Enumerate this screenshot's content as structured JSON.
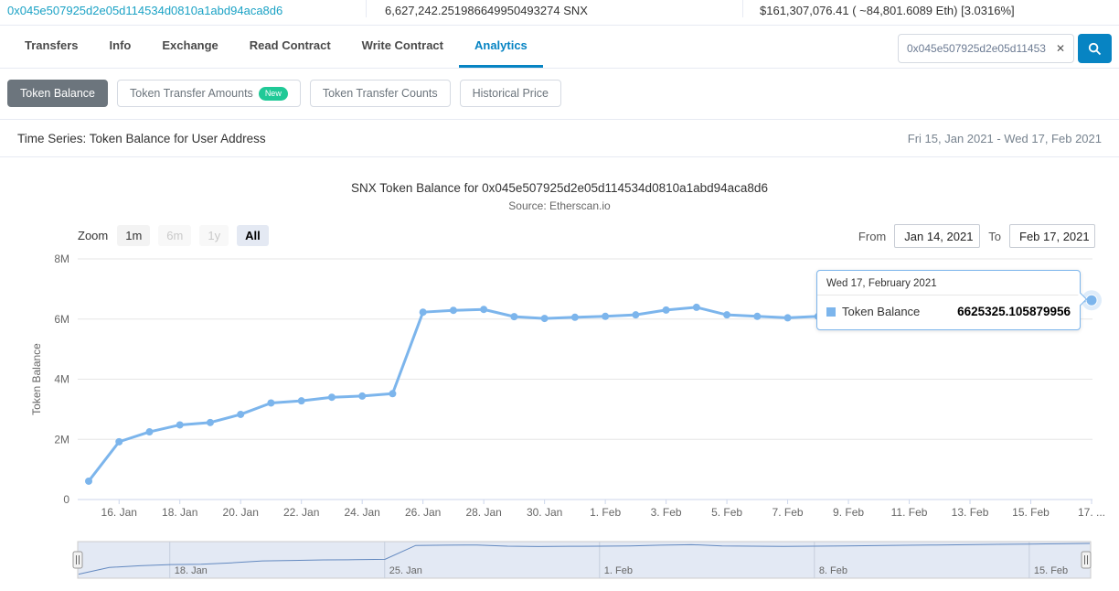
{
  "colors": {
    "accent": "#0784c3",
    "address_link": "#1ba2c5",
    "series": "#7cb5ec",
    "active_subtab_bg": "#6c757d",
    "new_badge_bg": "#20c997"
  },
  "topbar": {
    "address": "0x045e507925d2e05d114534d0810a1abd94aca8d6",
    "token_amount": "6,627,242.251986649950493274 SNX",
    "usd_value": "$161,307,076.41 ( ~84,801.6089 Eth) [3.0316%]"
  },
  "nav": {
    "tabs": [
      {
        "label": "Transfers"
      },
      {
        "label": "Info"
      },
      {
        "label": "Exchange"
      },
      {
        "label": "Read Contract"
      },
      {
        "label": "Write Contract"
      },
      {
        "label": "Analytics"
      }
    ],
    "search": {
      "value": "0x045e507925d2e05d11453...",
      "clear_glyph": "✕"
    }
  },
  "subtabs": {
    "token_balance": "Token Balance",
    "token_transfer_amounts": "Token Transfer Amounts",
    "new_badge": "New",
    "token_transfer_counts": "Token Transfer Counts",
    "historical_price": "Historical Price"
  },
  "panel": {
    "title": "Time Series: Token Balance for User Address",
    "date_range": "Fri 15, Jan 2021 - Wed 17, Feb 2021"
  },
  "toolbar": {
    "zoom_label": "Zoom",
    "zoom_buttons": [
      {
        "label": "1m",
        "state": "normal"
      },
      {
        "label": "6m",
        "state": "disabled"
      },
      {
        "label": "1y",
        "state": "disabled"
      },
      {
        "label": "All",
        "state": "active"
      }
    ],
    "from_label": "From",
    "from_value": "Jan 14, 2021",
    "to_label": "To",
    "to_value": "Feb 17, 2021"
  },
  "tooltip": {
    "header": "Wed 17, February 2021",
    "series_name": "Token Balance",
    "value": "6625325.105879956"
  },
  "chart_data": {
    "type": "line",
    "title": "SNX Token Balance for 0x045e507925d2e05d114534d0810a1abd94aca8d6",
    "subtitle": "Source: Etherscan.io",
    "xlabel": "",
    "ylabel": "Token Balance",
    "ylim": [
      0,
      8000000
    ],
    "grid": "horizontal",
    "legend": "none (hover tooltip)",
    "x": [
      "15. Jan",
      "16. Jan",
      "17. Jan",
      "18. Jan",
      "19. Jan",
      "20. Jan",
      "21. Jan",
      "22. Jan",
      "23. Jan",
      "24. Jan",
      "25. Jan",
      "26. Jan",
      "27. Jan",
      "28. Jan",
      "29. Jan",
      "30. Jan",
      "31. Jan",
      "1. Feb",
      "2. Feb",
      "3. Feb",
      "4. Feb",
      "5. Feb",
      "6. Feb",
      "7. Feb",
      "8. Feb",
      "9. Feb",
      "10. Feb",
      "11. Feb",
      "12. Feb",
      "13. Feb",
      "14. Feb",
      "15. Feb",
      "16. Feb",
      "17. Feb"
    ],
    "series": [
      {
        "name": "Token Balance",
        "color": "#7cb5ec",
        "values": [
          610000,
          1920000,
          2250000,
          2480000,
          2560000,
          2830000,
          3210000,
          3280000,
          3400000,
          3440000,
          3520000,
          6230000,
          6290000,
          6320000,
          6080000,
          6020000,
          6060000,
          6090000,
          6140000,
          6300000,
          6390000,
          6140000,
          6090000,
          6040000,
          6090000,
          6140000,
          6200000,
          6260000,
          6320000,
          6380000,
          6440000,
          6500000,
          6560000,
          6625325.105879956
        ]
      }
    ],
    "highlight_index": 33,
    "yticks": [
      {
        "value": 0,
        "label": "0"
      },
      {
        "value": 2000000,
        "label": "2M"
      },
      {
        "value": 4000000,
        "label": "4M"
      },
      {
        "value": 6000000,
        "label": "6M"
      },
      {
        "value": 8000000,
        "label": "8M"
      }
    ],
    "xticks": [
      {
        "index": 1,
        "label": "16. Jan"
      },
      {
        "index": 3,
        "label": "18. Jan"
      },
      {
        "index": 5,
        "label": "20. Jan"
      },
      {
        "index": 7,
        "label": "22. Jan"
      },
      {
        "index": 9,
        "label": "24. Jan"
      },
      {
        "index": 11,
        "label": "26. Jan"
      },
      {
        "index": 13,
        "label": "28. Jan"
      },
      {
        "index": 15,
        "label": "30. Jan"
      },
      {
        "index": 17,
        "label": "1. Feb"
      },
      {
        "index": 19,
        "label": "3. Feb"
      },
      {
        "index": 21,
        "label": "5. Feb"
      },
      {
        "index": 23,
        "label": "7. Feb"
      },
      {
        "index": 25,
        "label": "9. Feb"
      },
      {
        "index": 27,
        "label": "11. Feb"
      },
      {
        "index": 29,
        "label": "13. Feb"
      },
      {
        "index": 31,
        "label": "15. Feb"
      },
      {
        "index": 33,
        "label": "17. ..."
      }
    ],
    "navigator_ticks": [
      {
        "index": 3,
        "label": "18. Jan"
      },
      {
        "index": 10,
        "label": "25. Jan"
      },
      {
        "index": 17,
        "label": "1. Feb"
      },
      {
        "index": 24,
        "label": "8. Feb"
      },
      {
        "index": 31,
        "label": "15. Feb"
      }
    ]
  }
}
